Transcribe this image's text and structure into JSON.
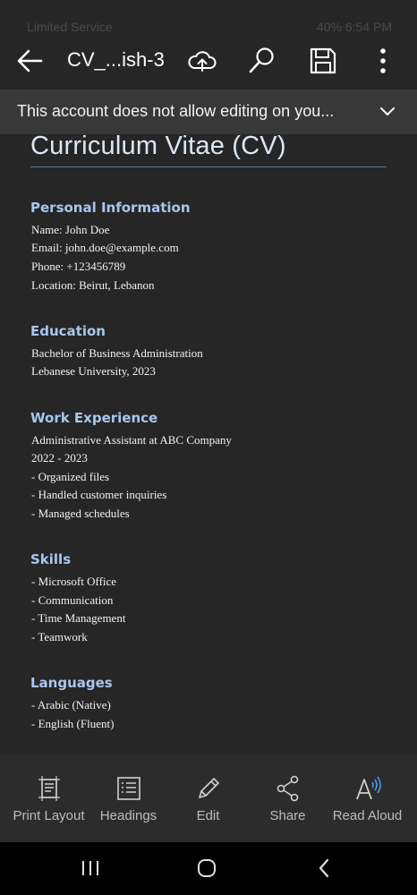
{
  "status_bar": {
    "left_text": "Limited Service",
    "right_text": "40% 6:54 PM"
  },
  "app_bar": {
    "title": "CV_...ish-3",
    "icons": [
      "back-arrow-icon",
      "cloud-upload-icon",
      "search-icon",
      "save-icon",
      "more-vertical-icon"
    ]
  },
  "banner": {
    "message": "This account does not allow editing on you..."
  },
  "document": {
    "title": "Curriculum Vitae (CV)",
    "sections": [
      {
        "heading": "Personal Information",
        "lines": [
          "Name: John Doe",
          "Email: john.doe@example.com",
          "Phone: +123456789",
          "Location: Beirut, Lebanon"
        ]
      },
      {
        "heading": "Education",
        "lines": [
          "Bachelor of Business Administration",
          "Lebanese University, 2023"
        ]
      },
      {
        "heading": "Work Experience",
        "lines": [
          "Administrative Assistant at ABC Company",
          "2022 - 2023",
          "- Organized files",
          "- Handled customer inquiries",
          "- Managed schedules"
        ]
      },
      {
        "heading": "Skills",
        "lines": [
          "- Microsoft Office",
          "- Communication",
          "- Time Management",
          "- Teamwork"
        ]
      },
      {
        "heading": "Languages",
        "lines": [
          "- Arabic (Native)",
          "- English (Fluent)"
        ]
      }
    ]
  },
  "bottom_toolbar": {
    "items": [
      {
        "label": "Print Layout",
        "icon": "print-layout-icon"
      },
      {
        "label": "Headings",
        "icon": "headings-icon"
      },
      {
        "label": "Edit",
        "icon": "pencil-icon"
      },
      {
        "label": "Share",
        "icon": "share-icon"
      },
      {
        "label": "Read Aloud",
        "icon": "read-aloud-icon"
      }
    ]
  },
  "nav_bar": {
    "icons": [
      "recent-apps-icon",
      "home-icon",
      "back-icon"
    ]
  },
  "colors": {
    "background": "#262626",
    "banner": "#383838",
    "heading": "#a9c6ee",
    "title": "#dde7f5",
    "accent_rule": "#4f7fb0",
    "read_aloud_accent": "#4aa3ff"
  }
}
